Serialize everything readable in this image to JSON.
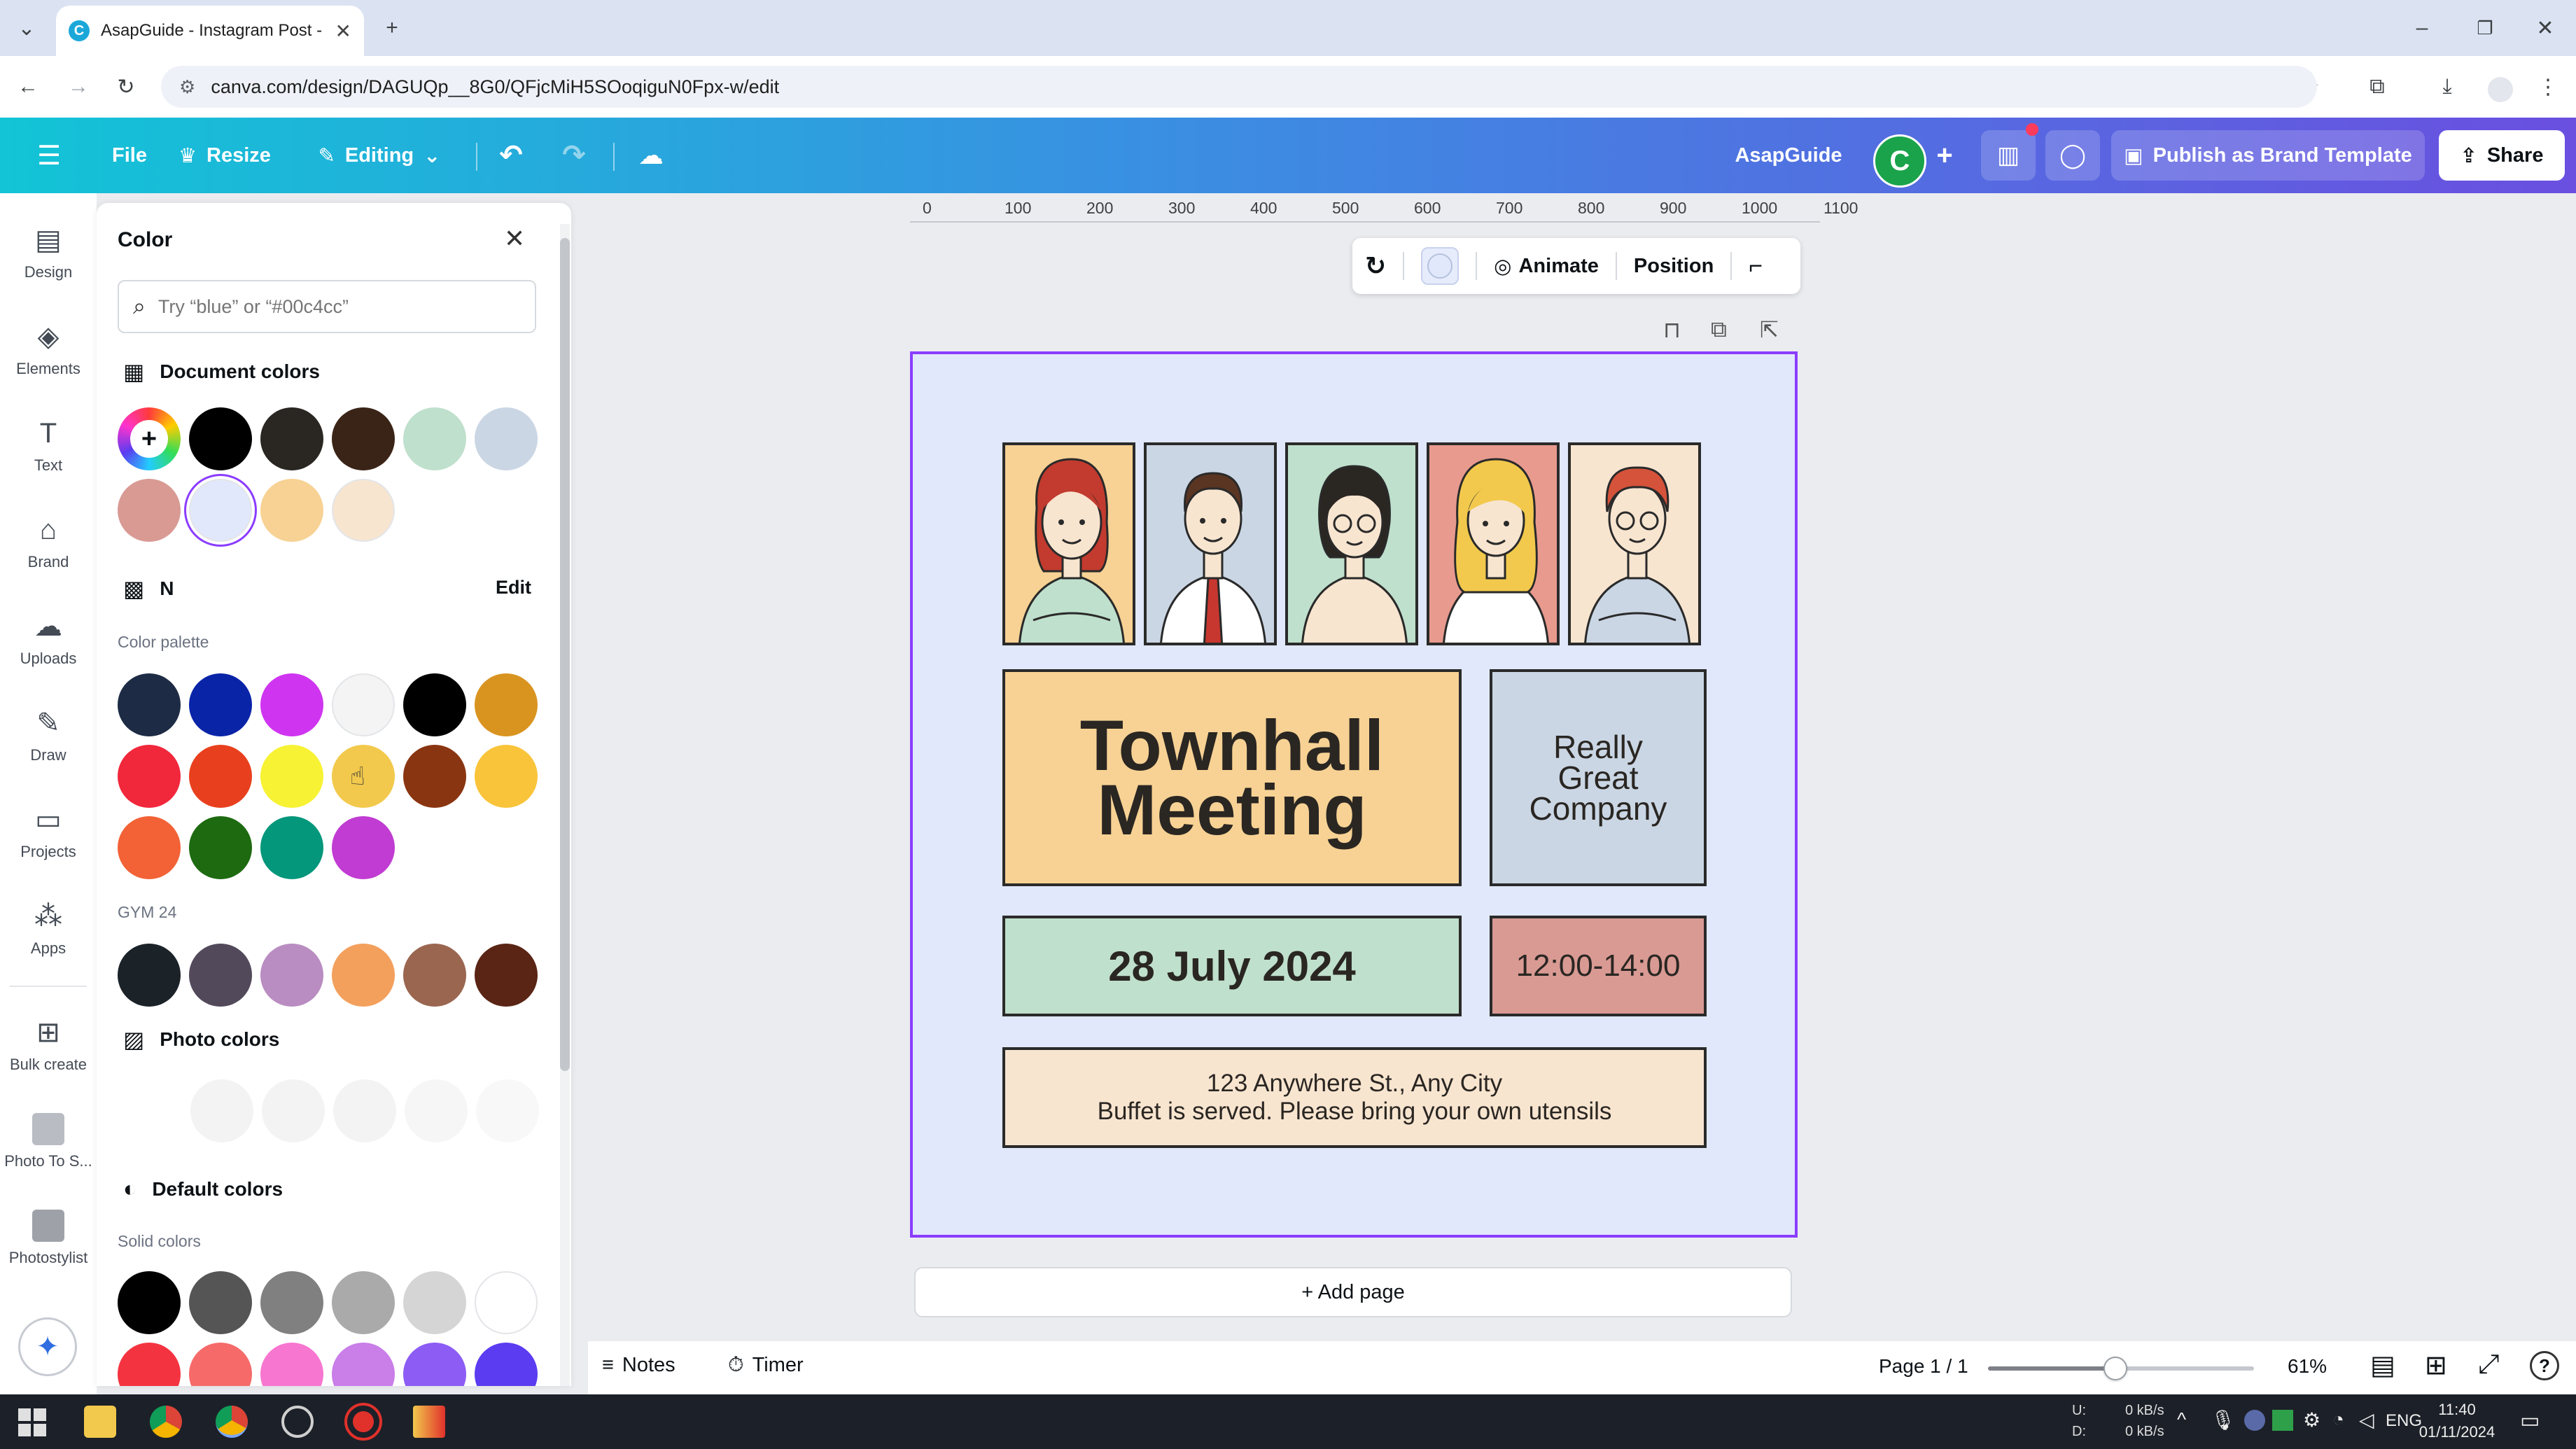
{
  "browser": {
    "tab_title": "AsapGuide - Instagram Post - C",
    "url": "canva.com/design/DAGUQp__8G0/QFjcMiH5SOoqiguN0Fpx-w/edit"
  },
  "toolbar": {
    "file": "File",
    "resize": "Resize",
    "editing": "Editing",
    "brand_name": "AsapGuide",
    "avatar_letter": "C",
    "publish": "Publish as Brand Template",
    "share": "Share"
  },
  "rail": {
    "items": [
      "Design",
      "Elements",
      "Text",
      "Brand",
      "Uploads",
      "Draw",
      "Projects",
      "Apps",
      "Bulk create",
      "Photo To S...",
      "Photostylist"
    ]
  },
  "panel": {
    "title": "Color",
    "search_placeholder": "Try “blue” or “#00c4cc”",
    "document_colors_title": "Document colors",
    "document_colors": [
      "#000000",
      "#2a2622",
      "#3a2417",
      "#bfe0cc",
      "#cad6e4",
      "#d99a94",
      "#e1e8fb",
      "#f7d294",
      "#f8e5d0"
    ],
    "kit_name": "N",
    "kit_edit": "Edit",
    "palette_label": "Color palette",
    "palette": [
      "#1d2b45",
      "#0a24a8",
      "#cf35f0",
      "#f4f4f4",
      "#000000",
      "#d99420",
      "#f1273c",
      "#e8401e",
      "#f7f233",
      "#f2c94c",
      "#8a3511",
      "#f9c43a",
      "#f26236",
      "#1d6a10",
      "#04977b",
      "#c03cd2"
    ],
    "gym_label": "GYM 24",
    "gym": [
      "#1b2228",
      "#52495b",
      "#b98dc1",
      "#f3a05d",
      "#9a6650",
      "#5a2515"
    ],
    "photo_colors_title": "Photo colors",
    "default_colors_title": "Default colors",
    "solid_label": "Solid colors",
    "solid": [
      "#000000",
      "#555555",
      "#808080",
      "#aaaaaa",
      "#d5d5d5",
      "#ffffff",
      "#f43341",
      "#f66a6a",
      "#f776d0",
      "#c97ee8",
      "#8c5cf5",
      "#5b3cf0"
    ]
  },
  "ruler": [
    "0",
    "100",
    "200",
    "300",
    "400",
    "500",
    "600",
    "700",
    "800",
    "900",
    "1000",
    "1100"
  ],
  "context_toolbar": {
    "animate": "Animate",
    "position": "Position"
  },
  "design": {
    "title_line1": "Townhall",
    "title_line2": "Meeting",
    "company_line1": "Really",
    "company_line2": "Great",
    "company_line3": "Company",
    "date": "28 July 2024",
    "time": "12:00-14:00",
    "address_line1": "123 Anywhere St., Any City",
    "address_line2": "Buffet is served. Please bring your own utensils"
  },
  "add_page": "+ Add page",
  "bottom": {
    "notes": "Notes",
    "timer": "Timer",
    "page": "Page 1 / 1",
    "zoom": "61%",
    "zoom_fraction": 0.48
  },
  "taskbar": {
    "net_up": "0 kB/s",
    "net_down": "0 kB/s",
    "net_up_label": "U:",
    "net_down_label": "D:",
    "lang": "ENG",
    "time": "11:40",
    "date": "01/11/2024"
  }
}
